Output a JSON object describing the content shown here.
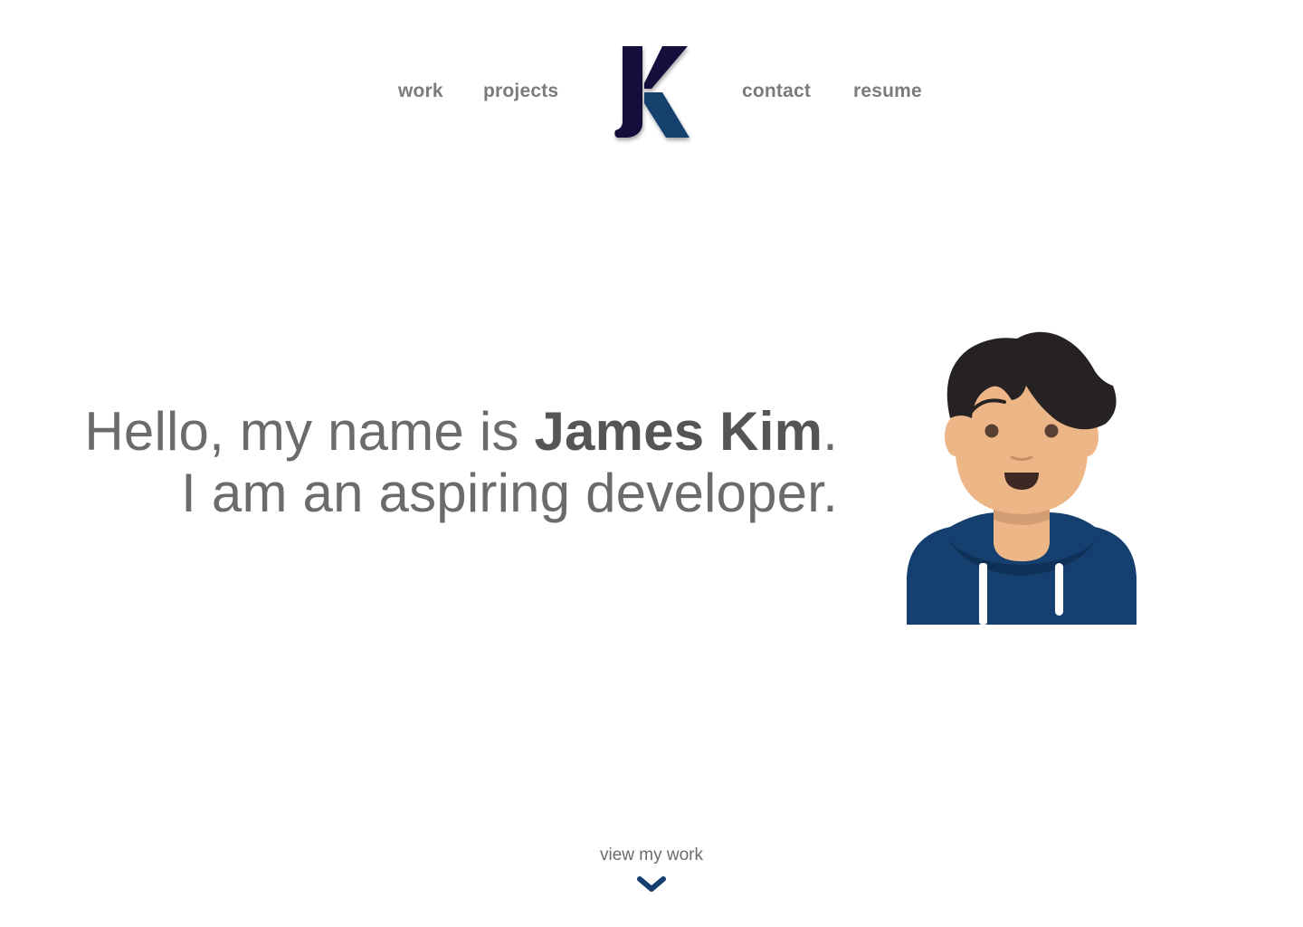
{
  "nav": {
    "links": [
      {
        "label": "work"
      },
      {
        "label": "projects"
      },
      {
        "label": "contact"
      },
      {
        "label": "resume"
      }
    ],
    "logo_icon": "jk-monogram-logo"
  },
  "hero": {
    "greeting_prefix": "Hello, my name is ",
    "name": "James Kim",
    "greeting_suffix": ".",
    "tagline": "I am an aspiring developer.",
    "avatar_icon": "developer-avatar-illustration"
  },
  "scroll_cue": {
    "label": "view my work",
    "icon": "chevron-down-icon"
  },
  "colors": {
    "nav_text": "#7b7b7b",
    "body_text": "#6b6b6b",
    "name_text": "#555555",
    "logo_dark": "#160f3d",
    "logo_blue": "#153f6e",
    "hoodie": "#153f6e",
    "skin": "#edb687",
    "hair": "#262223"
  }
}
